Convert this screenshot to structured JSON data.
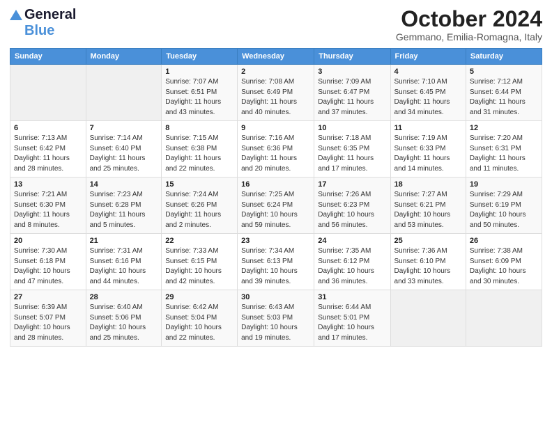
{
  "header": {
    "logo_general": "General",
    "logo_blue": "Blue",
    "month_title": "October 2024",
    "location": "Gemmano, Emilia-Romagna, Italy"
  },
  "days_of_week": [
    "Sunday",
    "Monday",
    "Tuesday",
    "Wednesday",
    "Thursday",
    "Friday",
    "Saturday"
  ],
  "weeks": [
    [
      {
        "day": "",
        "sunrise": "",
        "sunset": "",
        "daylight": ""
      },
      {
        "day": "",
        "sunrise": "",
        "sunset": "",
        "daylight": ""
      },
      {
        "day": "1",
        "sunrise": "Sunrise: 7:07 AM",
        "sunset": "Sunset: 6:51 PM",
        "daylight": "Daylight: 11 hours and 43 minutes."
      },
      {
        "day": "2",
        "sunrise": "Sunrise: 7:08 AM",
        "sunset": "Sunset: 6:49 PM",
        "daylight": "Daylight: 11 hours and 40 minutes."
      },
      {
        "day": "3",
        "sunrise": "Sunrise: 7:09 AM",
        "sunset": "Sunset: 6:47 PM",
        "daylight": "Daylight: 11 hours and 37 minutes."
      },
      {
        "day": "4",
        "sunrise": "Sunrise: 7:10 AM",
        "sunset": "Sunset: 6:45 PM",
        "daylight": "Daylight: 11 hours and 34 minutes."
      },
      {
        "day": "5",
        "sunrise": "Sunrise: 7:12 AM",
        "sunset": "Sunset: 6:44 PM",
        "daylight": "Daylight: 11 hours and 31 minutes."
      }
    ],
    [
      {
        "day": "6",
        "sunrise": "Sunrise: 7:13 AM",
        "sunset": "Sunset: 6:42 PM",
        "daylight": "Daylight: 11 hours and 28 minutes."
      },
      {
        "day": "7",
        "sunrise": "Sunrise: 7:14 AM",
        "sunset": "Sunset: 6:40 PM",
        "daylight": "Daylight: 11 hours and 25 minutes."
      },
      {
        "day": "8",
        "sunrise": "Sunrise: 7:15 AM",
        "sunset": "Sunset: 6:38 PM",
        "daylight": "Daylight: 11 hours and 22 minutes."
      },
      {
        "day": "9",
        "sunrise": "Sunrise: 7:16 AM",
        "sunset": "Sunset: 6:36 PM",
        "daylight": "Daylight: 11 hours and 20 minutes."
      },
      {
        "day": "10",
        "sunrise": "Sunrise: 7:18 AM",
        "sunset": "Sunset: 6:35 PM",
        "daylight": "Daylight: 11 hours and 17 minutes."
      },
      {
        "day": "11",
        "sunrise": "Sunrise: 7:19 AM",
        "sunset": "Sunset: 6:33 PM",
        "daylight": "Daylight: 11 hours and 14 minutes."
      },
      {
        "day": "12",
        "sunrise": "Sunrise: 7:20 AM",
        "sunset": "Sunset: 6:31 PM",
        "daylight": "Daylight: 11 hours and 11 minutes."
      }
    ],
    [
      {
        "day": "13",
        "sunrise": "Sunrise: 7:21 AM",
        "sunset": "Sunset: 6:30 PM",
        "daylight": "Daylight: 11 hours and 8 minutes."
      },
      {
        "day": "14",
        "sunrise": "Sunrise: 7:23 AM",
        "sunset": "Sunset: 6:28 PM",
        "daylight": "Daylight: 11 hours and 5 minutes."
      },
      {
        "day": "15",
        "sunrise": "Sunrise: 7:24 AM",
        "sunset": "Sunset: 6:26 PM",
        "daylight": "Daylight: 11 hours and 2 minutes."
      },
      {
        "day": "16",
        "sunrise": "Sunrise: 7:25 AM",
        "sunset": "Sunset: 6:24 PM",
        "daylight": "Daylight: 10 hours and 59 minutes."
      },
      {
        "day": "17",
        "sunrise": "Sunrise: 7:26 AM",
        "sunset": "Sunset: 6:23 PM",
        "daylight": "Daylight: 10 hours and 56 minutes."
      },
      {
        "day": "18",
        "sunrise": "Sunrise: 7:27 AM",
        "sunset": "Sunset: 6:21 PM",
        "daylight": "Daylight: 10 hours and 53 minutes."
      },
      {
        "day": "19",
        "sunrise": "Sunrise: 7:29 AM",
        "sunset": "Sunset: 6:19 PM",
        "daylight": "Daylight: 10 hours and 50 minutes."
      }
    ],
    [
      {
        "day": "20",
        "sunrise": "Sunrise: 7:30 AM",
        "sunset": "Sunset: 6:18 PM",
        "daylight": "Daylight: 10 hours and 47 minutes."
      },
      {
        "day": "21",
        "sunrise": "Sunrise: 7:31 AM",
        "sunset": "Sunset: 6:16 PM",
        "daylight": "Daylight: 10 hours and 44 minutes."
      },
      {
        "day": "22",
        "sunrise": "Sunrise: 7:33 AM",
        "sunset": "Sunset: 6:15 PM",
        "daylight": "Daylight: 10 hours and 42 minutes."
      },
      {
        "day": "23",
        "sunrise": "Sunrise: 7:34 AM",
        "sunset": "Sunset: 6:13 PM",
        "daylight": "Daylight: 10 hours and 39 minutes."
      },
      {
        "day": "24",
        "sunrise": "Sunrise: 7:35 AM",
        "sunset": "Sunset: 6:12 PM",
        "daylight": "Daylight: 10 hours and 36 minutes."
      },
      {
        "day": "25",
        "sunrise": "Sunrise: 7:36 AM",
        "sunset": "Sunset: 6:10 PM",
        "daylight": "Daylight: 10 hours and 33 minutes."
      },
      {
        "day": "26",
        "sunrise": "Sunrise: 7:38 AM",
        "sunset": "Sunset: 6:09 PM",
        "daylight": "Daylight: 10 hours and 30 minutes."
      }
    ],
    [
      {
        "day": "27",
        "sunrise": "Sunrise: 6:39 AM",
        "sunset": "Sunset: 5:07 PM",
        "daylight": "Daylight: 10 hours and 28 minutes."
      },
      {
        "day": "28",
        "sunrise": "Sunrise: 6:40 AM",
        "sunset": "Sunset: 5:06 PM",
        "daylight": "Daylight: 10 hours and 25 minutes."
      },
      {
        "day": "29",
        "sunrise": "Sunrise: 6:42 AM",
        "sunset": "Sunset: 5:04 PM",
        "daylight": "Daylight: 10 hours and 22 minutes."
      },
      {
        "day": "30",
        "sunrise": "Sunrise: 6:43 AM",
        "sunset": "Sunset: 5:03 PM",
        "daylight": "Daylight: 10 hours and 19 minutes."
      },
      {
        "day": "31",
        "sunrise": "Sunrise: 6:44 AM",
        "sunset": "Sunset: 5:01 PM",
        "daylight": "Daylight: 10 hours and 17 minutes."
      },
      {
        "day": "",
        "sunrise": "",
        "sunset": "",
        "daylight": ""
      },
      {
        "day": "",
        "sunrise": "",
        "sunset": "",
        "daylight": ""
      }
    ]
  ]
}
